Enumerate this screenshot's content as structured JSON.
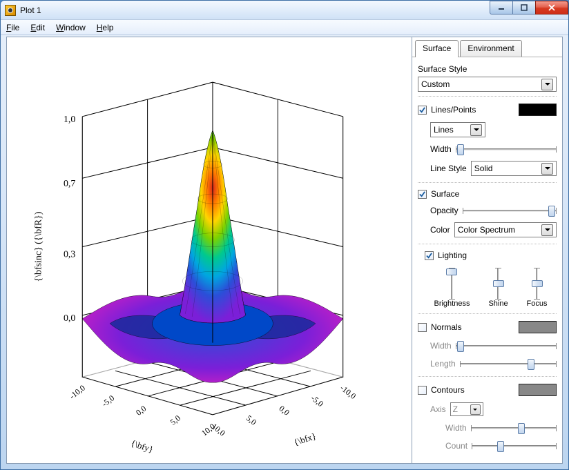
{
  "window": {
    "title": "Plot 1"
  },
  "menu": {
    "file": "File",
    "edit": "Edit",
    "window": "Window",
    "help": "Help"
  },
  "tabs": {
    "surface": "Surface",
    "environment": "Environment"
  },
  "surface": {
    "style_label": "Surface Style",
    "style_value": "Custom",
    "lines_points": "Lines/Points",
    "lines_value": "Lines",
    "width_label": "Width",
    "line_style_label": "Line Style",
    "line_style_value": "Solid",
    "surface_label": "Surface",
    "opacity_label": "Opacity",
    "color_label": "Color",
    "color_value": "Color Spectrum",
    "lighting_label": "Lighting",
    "brightness_label": "Brightness",
    "shine_label": "Shine",
    "focus_label": "Focus",
    "normals_label": "Normals",
    "normals_width_label": "Width",
    "normals_length_label": "Length",
    "contours_label": "Contours",
    "contours_axis_label": "Axis",
    "contours_axis_value": "Z",
    "contours_width_label": "Width",
    "contours_count_label": "Count"
  },
  "chart_data": {
    "type": "surface3d",
    "title": "",
    "xlabel": "{\\bfx}",
    "ylabel": "{\\bfy}",
    "zlabel": "{\\bfsinc}  ({\\bfR})",
    "x_ticks": [
      -10.0,
      -5.0,
      0.0,
      5.0,
      10.0
    ],
    "y_ticks": [
      -10.0,
      -5.0,
      0.0,
      5.0,
      10.0
    ],
    "z_ticks": [
      0.0,
      0.3,
      0.7,
      1.0
    ],
    "xlim": [
      -10,
      10
    ],
    "ylim": [
      -10,
      10
    ],
    "zlim": [
      -0.2,
      1.0
    ],
    "function": "sinc(sqrt(x^2+y^2))",
    "colormap": "spectrum"
  }
}
